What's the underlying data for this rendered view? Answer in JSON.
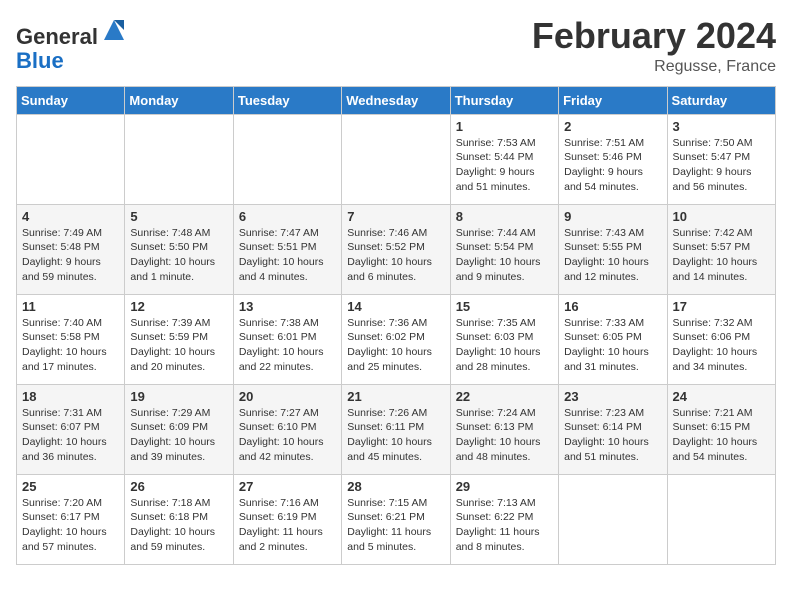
{
  "header": {
    "logo_general": "General",
    "logo_blue": "Blue",
    "month_title": "February 2024",
    "location": "Regusse, France"
  },
  "columns": [
    "Sunday",
    "Monday",
    "Tuesday",
    "Wednesday",
    "Thursday",
    "Friday",
    "Saturday"
  ],
  "weeks": [
    [
      {
        "day": "",
        "info": ""
      },
      {
        "day": "",
        "info": ""
      },
      {
        "day": "",
        "info": ""
      },
      {
        "day": "",
        "info": ""
      },
      {
        "day": "1",
        "info": "Sunrise: 7:53 AM\nSunset: 5:44 PM\nDaylight: 9 hours\nand 51 minutes."
      },
      {
        "day": "2",
        "info": "Sunrise: 7:51 AM\nSunset: 5:46 PM\nDaylight: 9 hours\nand 54 minutes."
      },
      {
        "day": "3",
        "info": "Sunrise: 7:50 AM\nSunset: 5:47 PM\nDaylight: 9 hours\nand 56 minutes."
      }
    ],
    [
      {
        "day": "4",
        "info": "Sunrise: 7:49 AM\nSunset: 5:48 PM\nDaylight: 9 hours\nand 59 minutes."
      },
      {
        "day": "5",
        "info": "Sunrise: 7:48 AM\nSunset: 5:50 PM\nDaylight: 10 hours\nand 1 minute."
      },
      {
        "day": "6",
        "info": "Sunrise: 7:47 AM\nSunset: 5:51 PM\nDaylight: 10 hours\nand 4 minutes."
      },
      {
        "day": "7",
        "info": "Sunrise: 7:46 AM\nSunset: 5:52 PM\nDaylight: 10 hours\nand 6 minutes."
      },
      {
        "day": "8",
        "info": "Sunrise: 7:44 AM\nSunset: 5:54 PM\nDaylight: 10 hours\nand 9 minutes."
      },
      {
        "day": "9",
        "info": "Sunrise: 7:43 AM\nSunset: 5:55 PM\nDaylight: 10 hours\nand 12 minutes."
      },
      {
        "day": "10",
        "info": "Sunrise: 7:42 AM\nSunset: 5:57 PM\nDaylight: 10 hours\nand 14 minutes."
      }
    ],
    [
      {
        "day": "11",
        "info": "Sunrise: 7:40 AM\nSunset: 5:58 PM\nDaylight: 10 hours\nand 17 minutes."
      },
      {
        "day": "12",
        "info": "Sunrise: 7:39 AM\nSunset: 5:59 PM\nDaylight: 10 hours\nand 20 minutes."
      },
      {
        "day": "13",
        "info": "Sunrise: 7:38 AM\nSunset: 6:01 PM\nDaylight: 10 hours\nand 22 minutes."
      },
      {
        "day": "14",
        "info": "Sunrise: 7:36 AM\nSunset: 6:02 PM\nDaylight: 10 hours\nand 25 minutes."
      },
      {
        "day": "15",
        "info": "Sunrise: 7:35 AM\nSunset: 6:03 PM\nDaylight: 10 hours\nand 28 minutes."
      },
      {
        "day": "16",
        "info": "Sunrise: 7:33 AM\nSunset: 6:05 PM\nDaylight: 10 hours\nand 31 minutes."
      },
      {
        "day": "17",
        "info": "Sunrise: 7:32 AM\nSunset: 6:06 PM\nDaylight: 10 hours\nand 34 minutes."
      }
    ],
    [
      {
        "day": "18",
        "info": "Sunrise: 7:31 AM\nSunset: 6:07 PM\nDaylight: 10 hours\nand 36 minutes."
      },
      {
        "day": "19",
        "info": "Sunrise: 7:29 AM\nSunset: 6:09 PM\nDaylight: 10 hours\nand 39 minutes."
      },
      {
        "day": "20",
        "info": "Sunrise: 7:27 AM\nSunset: 6:10 PM\nDaylight: 10 hours\nand 42 minutes."
      },
      {
        "day": "21",
        "info": "Sunrise: 7:26 AM\nSunset: 6:11 PM\nDaylight: 10 hours\nand 45 minutes."
      },
      {
        "day": "22",
        "info": "Sunrise: 7:24 AM\nSunset: 6:13 PM\nDaylight: 10 hours\nand 48 minutes."
      },
      {
        "day": "23",
        "info": "Sunrise: 7:23 AM\nSunset: 6:14 PM\nDaylight: 10 hours\nand 51 minutes."
      },
      {
        "day": "24",
        "info": "Sunrise: 7:21 AM\nSunset: 6:15 PM\nDaylight: 10 hours\nand 54 minutes."
      }
    ],
    [
      {
        "day": "25",
        "info": "Sunrise: 7:20 AM\nSunset: 6:17 PM\nDaylight: 10 hours\nand 57 minutes."
      },
      {
        "day": "26",
        "info": "Sunrise: 7:18 AM\nSunset: 6:18 PM\nDaylight: 10 hours\nand 59 minutes."
      },
      {
        "day": "27",
        "info": "Sunrise: 7:16 AM\nSunset: 6:19 PM\nDaylight: 11 hours\nand 2 minutes."
      },
      {
        "day": "28",
        "info": "Sunrise: 7:15 AM\nSunset: 6:21 PM\nDaylight: 11 hours\nand 5 minutes."
      },
      {
        "day": "29",
        "info": "Sunrise: 7:13 AM\nSunset: 6:22 PM\nDaylight: 11 hours\nand 8 minutes."
      },
      {
        "day": "",
        "info": ""
      },
      {
        "day": "",
        "info": ""
      }
    ]
  ]
}
